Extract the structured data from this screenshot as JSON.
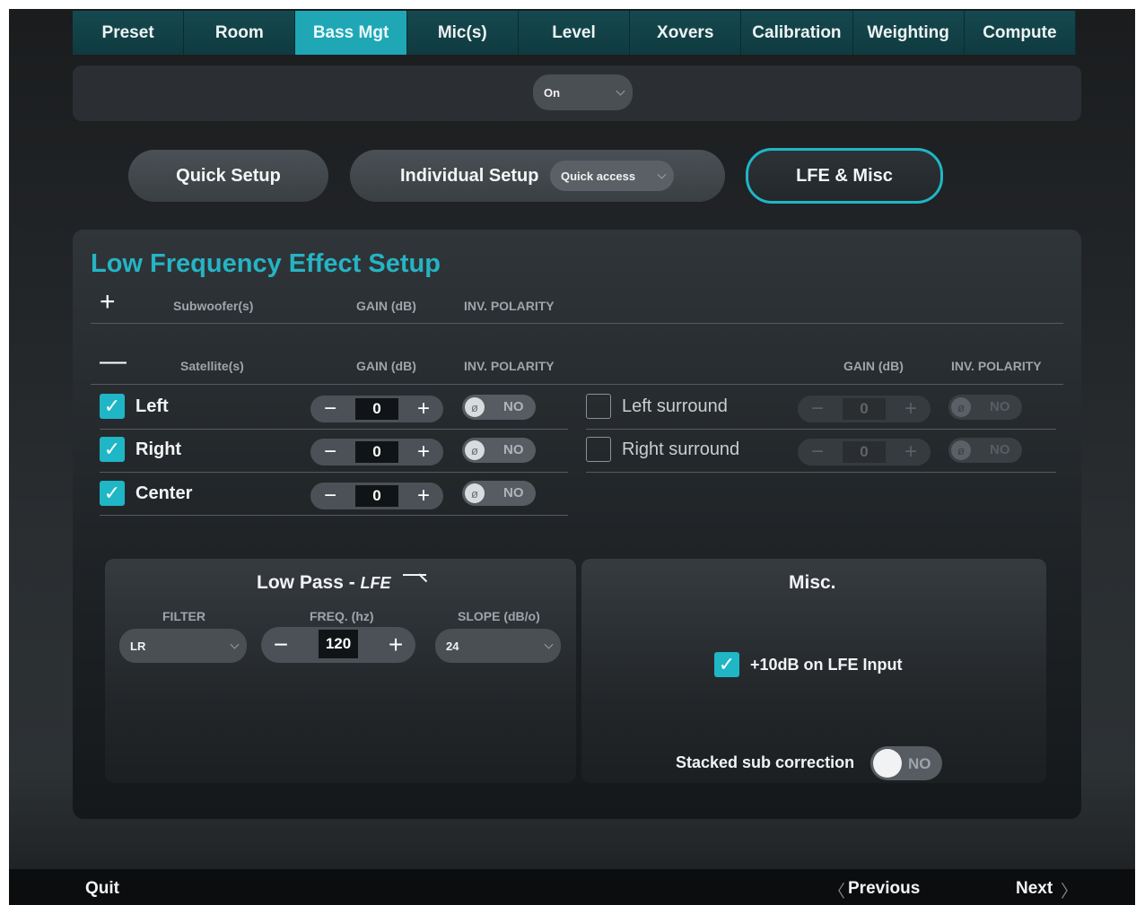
{
  "tabs": [
    {
      "label": "Preset"
    },
    {
      "label": "Room"
    },
    {
      "label": "Bass Mgt"
    },
    {
      "label": "Mic(s)"
    },
    {
      "label": "Level"
    },
    {
      "label": "Xovers"
    },
    {
      "label": "Calibration"
    },
    {
      "label": "Weighting"
    },
    {
      "label": "Compute"
    }
  ],
  "active_tab": "Bass Mgt",
  "bass_mode": {
    "value": "On"
  },
  "setup_buttons": {
    "quick": "Quick Setup",
    "individual": "Individual Setup",
    "quick_access": "Quick access",
    "lfe": "LFE & Misc"
  },
  "panel": {
    "title": "Low Frequency Effect Setup",
    "subwoofer_header": {
      "section": "Subwoofer(s)",
      "gain": "GAIN (dB)",
      "polarity": "INV. POLARITY"
    },
    "satellite_header": {
      "section": "Satellite(s)",
      "gain": "GAIN (dB)",
      "polarity": "INV. POLARITY",
      "gain2": "GAIN (dB)",
      "polarity2": "INV. POLARITY"
    },
    "left_channels": [
      {
        "label": "Left",
        "checked": true,
        "gain": "0",
        "polarity": "NO"
      },
      {
        "label": "Right",
        "checked": true,
        "gain": "0",
        "polarity": "NO"
      },
      {
        "label": "Center",
        "checked": true,
        "gain": "0",
        "polarity": "NO"
      }
    ],
    "right_channels": [
      {
        "label": "Left surround",
        "checked": false,
        "gain": "0",
        "polarity": "NO"
      },
      {
        "label": "Right surround",
        "checked": false,
        "gain": "0",
        "polarity": "NO"
      }
    ]
  },
  "lowpass": {
    "title": "Low Pass - ",
    "title_em": "LFE",
    "filter_label": "FILTER",
    "freq_label": "FREQ. (hz)",
    "slope_label": "SLOPE (dB/o)",
    "filter_value": "LR",
    "freq_value": "120",
    "slope_value": "24"
  },
  "misc": {
    "title": "Misc.",
    "lfe_input_label": "+10dB on LFE Input",
    "lfe_input_checked": true,
    "stacked_label": "Stacked sub correction",
    "stacked_value": "NO"
  },
  "footer": {
    "quit": "Quit",
    "previous": "Previous",
    "next": "Next"
  },
  "colors": {
    "accent": "#1fb6c6",
    "title": "#25b4c4",
    "background": "#22262a"
  }
}
